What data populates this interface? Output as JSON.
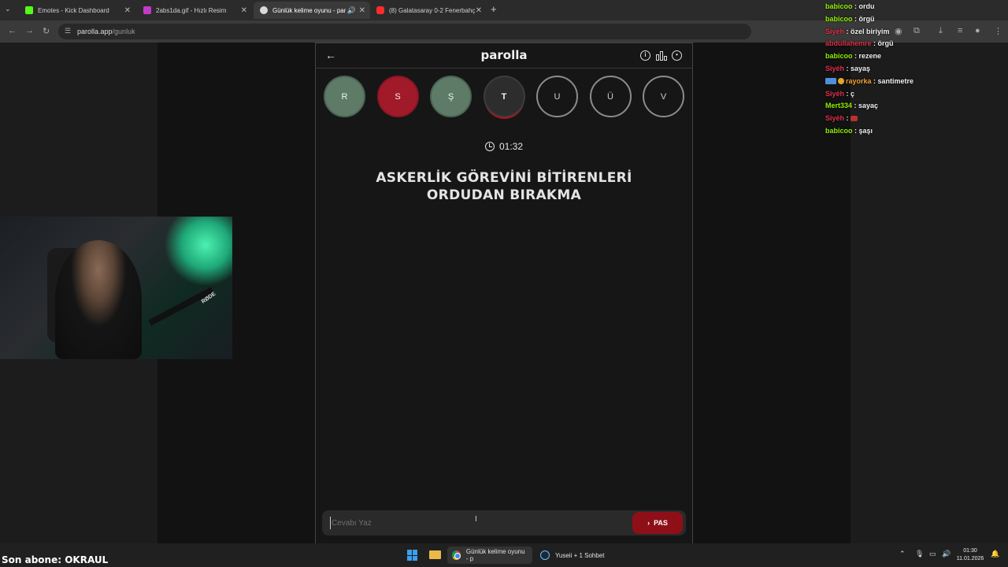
{
  "browser": {
    "tabs": [
      {
        "label": "Emotes - Kick Dashboard",
        "color": "#53fc18",
        "active": false
      },
      {
        "label": "2abs1da.gif - Hızlı Resim",
        "color": "#c03bc7",
        "active": false
      },
      {
        "label": "Günlük kelime oyunu - par",
        "color": "#d9d9d9",
        "active": true
      },
      {
        "label": "(8) Galatasaray 0-2 Fenerbahç",
        "color": "#ff2d2d",
        "active": false
      }
    ],
    "url_host": "parolla.app",
    "url_path": "/gunluk"
  },
  "game": {
    "logo": "parolla",
    "letters": [
      {
        "char": "R",
        "state": "correct"
      },
      {
        "char": "S",
        "state": "wrong"
      },
      {
        "char": "Ş",
        "state": "correct"
      },
      {
        "char": "T",
        "state": "current"
      },
      {
        "char": "U",
        "state": "pending"
      },
      {
        "char": "Ü",
        "state": "pending"
      },
      {
        "char": "V",
        "state": "pending"
      }
    ],
    "timer": "01:32",
    "question_line1": "ASKERLİK GÖREVİNİ BİTİRENLERİ",
    "question_line2": "ORDUDAN BIRAKMA",
    "answer_placeholder": "Cevabı Yaz",
    "pass_label": "PAS"
  },
  "chat": [
    {
      "user": "babicoo",
      "user_color": "#8ff000",
      "msg": "ordu"
    },
    {
      "user": "babicoo",
      "user_color": "#8ff000",
      "msg": "örgü"
    },
    {
      "user": "Siyéh",
      "user_color": "#e0304a",
      "msg": "özel biriyim"
    },
    {
      "user": "abdullahemre",
      "user_color": "#e0304a",
      "msg": "örgü"
    },
    {
      "user": "babicoo",
      "user_color": "#8ff000",
      "msg": "rezene"
    },
    {
      "user": "Siyéh",
      "user_color": "#e0304a",
      "msg": "sayaş"
    },
    {
      "user": "rayorka",
      "user_color": "#f0a030",
      "msg": "santimetre",
      "badges": true
    },
    {
      "user": "Siyéh",
      "user_color": "#e0304a",
      "msg": "ç"
    },
    {
      "user": "Mert334",
      "user_color": "#8ff000",
      "msg": "sayaç"
    },
    {
      "user": "Siyéh",
      "user_color": "#e0304a",
      "msg": "",
      "emote": true
    },
    {
      "user": "babicoo",
      "user_color": "#8ff000",
      "msg": "şaşı"
    }
  ],
  "stream": {
    "sub_label": "Son abone: OKRAUL"
  },
  "taskbar": {
    "chrome_app": "Günlük kelime oyunu - p",
    "steam_app": "Yuseii + 1 Sohbet",
    "time": "01:30",
    "date": "11.01.2026"
  },
  "colors": {
    "correct": "#5d7b66",
    "wrong": "#a11a2a",
    "pass_button": "#8e0f17"
  }
}
